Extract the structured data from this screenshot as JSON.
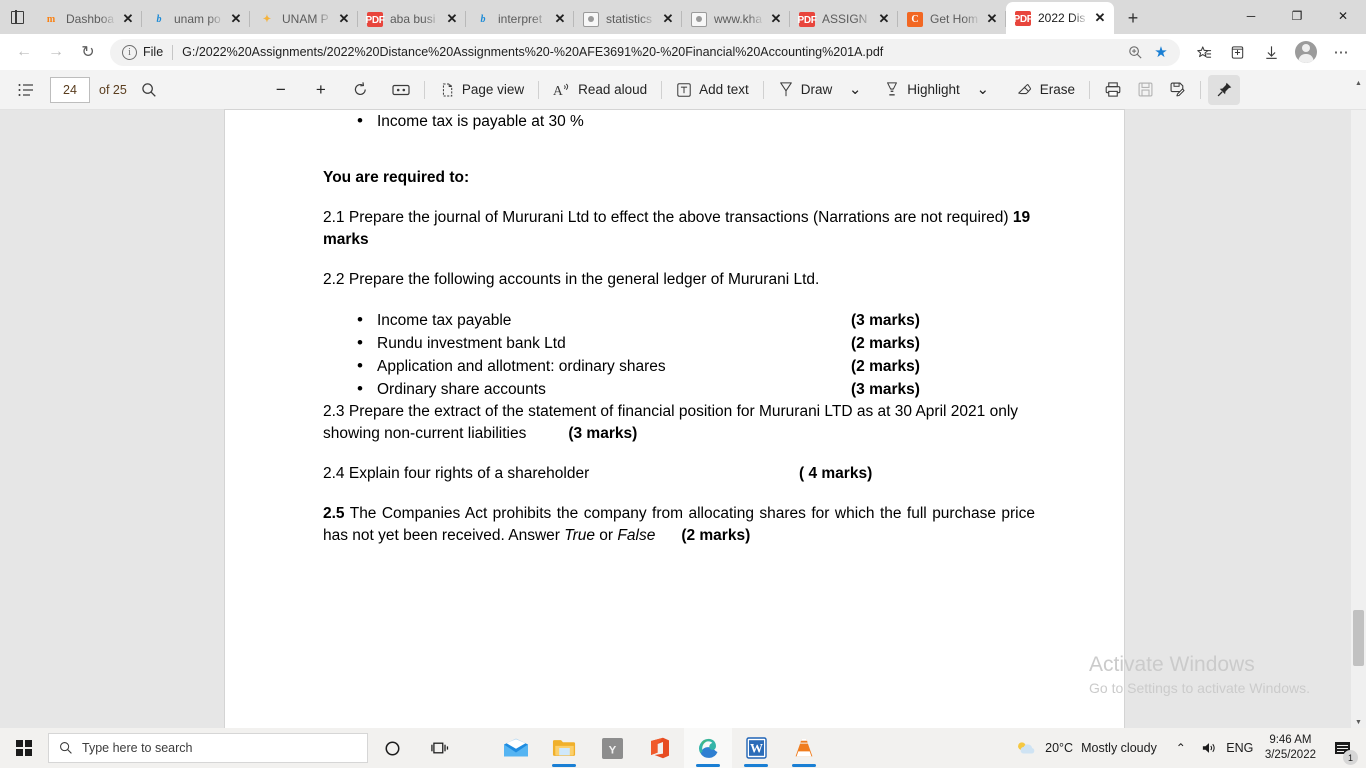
{
  "browser": {
    "tab_list_icon": "tab-list-icon",
    "tabs": [
      {
        "title": "Dashboa",
        "favicon": "moodle-icon",
        "active": false
      },
      {
        "title": "unam po",
        "favicon": "bing-icon",
        "active": false
      },
      {
        "title": "UNAM P",
        "favicon": "star-icon",
        "active": false
      },
      {
        "title": "aba busi",
        "favicon": "pdf-icon",
        "active": false
      },
      {
        "title": "interpret",
        "favicon": "bing-icon",
        "active": false
      },
      {
        "title": "statistics",
        "favicon": "document-icon",
        "active": false
      },
      {
        "title": "www.kha",
        "favicon": "document-icon",
        "active": false
      },
      {
        "title": "ASSIGN",
        "favicon": "pdf-icon",
        "active": false
      },
      {
        "title": "Get Hom",
        "favicon": "chegg-icon",
        "active": false
      },
      {
        "title": "2022 Dis",
        "favicon": "pdf-icon",
        "active": true
      }
    ],
    "new_tab_label": "+",
    "close_tab_label": "✕",
    "window_controls": {
      "minimize": "─",
      "restore": "❐",
      "close": "✕"
    },
    "nav": {
      "back": "←",
      "forward": "→",
      "reload": "↻"
    },
    "omnibox": {
      "info_icon": "i",
      "scheme_label": "File",
      "url": "G:/2022%20Assignments/2022%20Distance%20Assignments%20-%20AFE3691%20-%20Financial%20Accounting%201A.pdf",
      "zoom_icon": "zoom-icon",
      "favorite_icon": "star-filled-icon",
      "favorites_icon": "favorites-icon",
      "collections_icon": "collections-icon",
      "downloads_icon": "downloads-icon",
      "profile_icon": "profile-icon",
      "settings_icon": "more-icon"
    }
  },
  "pdf_toolbar": {
    "toc_label": "table-of-contents-icon",
    "page_number": "24",
    "page_total": "of 25",
    "search_icon": "search-icon",
    "zoom_out": "−",
    "zoom_in": "+",
    "rotate": "rotate-icon",
    "fit_page": "fit-page-icon",
    "page_view_label": "Page view",
    "read_aloud_label": "Read aloud",
    "add_text_label": "Add text",
    "draw_label": "Draw",
    "highlight_label": "Highlight",
    "erase_label": "Erase",
    "print_icon": "print-icon",
    "save_icon": "save-icon",
    "save_as_icon": "save-as-icon",
    "pin_icon": "pin-icon",
    "chevron": "⌄"
  },
  "document": {
    "bullet_top": "Income tax is payable at 30 %",
    "required_heading": "You are required to:",
    "q21_text": "2.1 Prepare the journal of Mururani Ltd to effect the above transactions (Narrations are not required) ",
    "q21_marks": "19 marks",
    "q22_text": "2.2 Prepare the following accounts in the general ledger of Mururani Ltd.",
    "accounts": [
      {
        "label": "Income tax payable",
        "marks": "(3 marks)"
      },
      {
        "label": "Rundu investment bank Ltd",
        "marks": "(2 marks)"
      },
      {
        "label": "Application and allotment: ordinary shares",
        "marks": "(2 marks)"
      },
      {
        "label": "Ordinary share accounts",
        "marks": "(3 marks)"
      }
    ],
    "q23_text": "2.3 Prepare the extract of the statement of financial position for Mururani LTD as at 30 April 2021 only showing non-current liabilities",
    "q23_marks": "(3 marks)",
    "q24_text": "2.4 Explain four rights of a shareholder",
    "q24_marks": "( 4 marks)",
    "q25_number": "2.5",
    "q25_text_a": " The Companies Act prohibits the company from allocating shares for which the full purchase price has not yet been received. Answer ",
    "q25_true": "True",
    "q25_or": " or ",
    "q25_false": "False",
    "q25_marks": "(2 marks)"
  },
  "watermark": {
    "line1": "Activate Windows",
    "line2": "Go to Settings to activate Windows."
  },
  "taskbar": {
    "start_icon": "windows-start-icon",
    "search_placeholder": "Type here to search",
    "search_icon": "search-icon",
    "cortana_icon": "cortana-icon",
    "task_view_icon": "task-view-icon",
    "apps": [
      {
        "name": "mail-icon",
        "running": false
      },
      {
        "name": "file-explorer-icon",
        "running": true
      },
      {
        "name": "yandex-icon",
        "running": false
      },
      {
        "name": "office-icon",
        "running": false
      },
      {
        "name": "edge-icon",
        "running": true
      },
      {
        "name": "word-icon",
        "running": true
      },
      {
        "name": "vlc-icon",
        "running": true
      }
    ],
    "weather_temp": "20°C",
    "weather_desc": "Mostly cloudy",
    "tray_chevron": "⌃",
    "volume_icon": "volume-icon",
    "language": "ENG",
    "time": "9:46 AM",
    "date": "3/25/2022",
    "notification_count": "1"
  },
  "colors": {
    "accent": "#1a7fd4",
    "pdf_red": "#e8453c",
    "tabstrip": "#dadada",
    "viewer_bg": "#e6e6e6"
  }
}
